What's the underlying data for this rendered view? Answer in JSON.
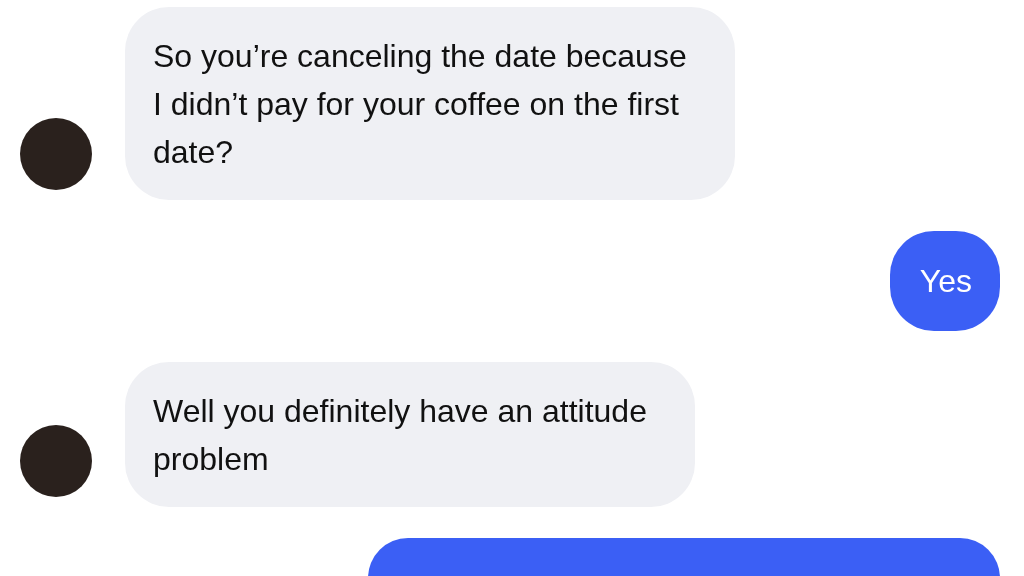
{
  "messages": [
    {
      "kind": "received",
      "text": "So you’re canceling the date because\nI didn’t pay for your coffee on the first\ndate?"
    },
    {
      "kind": "sent",
      "text": "Yes"
    },
    {
      "kind": "received",
      "text": "Well you definitely have an attitude\nproblem"
    },
    {
      "kind": "sent"
    }
  ]
}
